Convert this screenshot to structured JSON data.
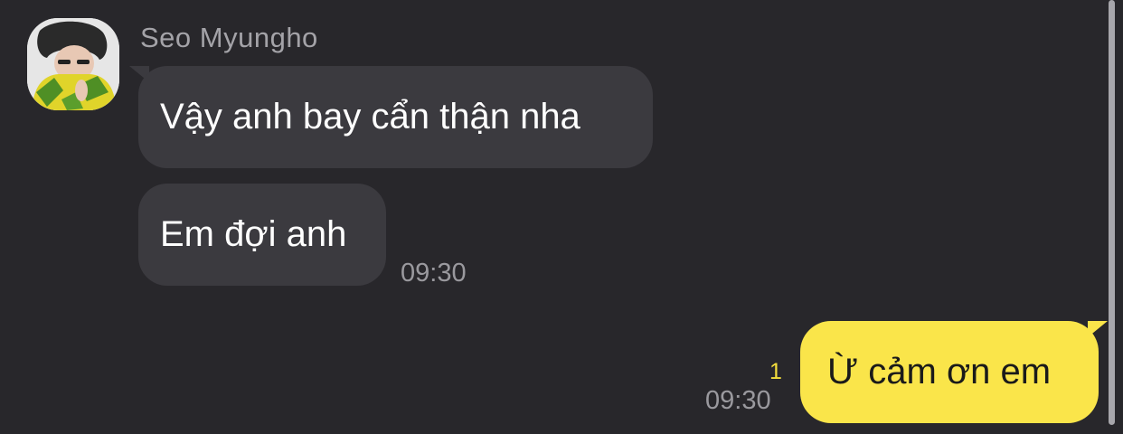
{
  "conversation": {
    "incoming": {
      "sender_name": "Seo Myungho",
      "avatar_icon": "profile-photo",
      "messages": [
        {
          "text": "Vậy anh bay cẩn thận nha"
        },
        {
          "text": "Em đợi anh"
        }
      ],
      "time": "09:30"
    },
    "outgoing": {
      "messages": [
        {
          "text": "Ừ cảm ơn em"
        }
      ],
      "unread_count": "1",
      "time": "09:30"
    }
  },
  "colors": {
    "background": "#28272b",
    "incoming_bubble": "#3b3a3f",
    "outgoing_bubble": "#fae54a",
    "unread_count": "#f4de3c",
    "timestamp": "#9a999e"
  }
}
